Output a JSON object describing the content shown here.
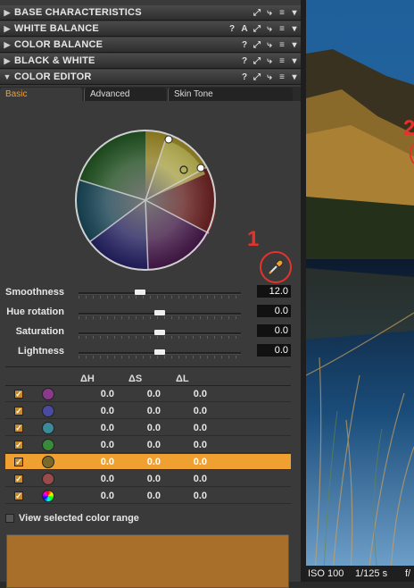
{
  "tools": [
    {
      "name": "BASE CHARACTERISTICS",
      "icons": [
        "⤢",
        "⤷",
        "≡",
        "▾"
      ]
    },
    {
      "name": "WHITE BALANCE",
      "icons": [
        "?",
        "A",
        "⤢",
        "⤷",
        "≡",
        "▾"
      ]
    },
    {
      "name": "COLOR BALANCE",
      "icons": [
        "?",
        "⤢",
        "⤷",
        "≡",
        "▾"
      ]
    },
    {
      "name": "BLACK & WHITE",
      "icons": [
        "?",
        "⤢",
        "⤷",
        "≡",
        "▾"
      ]
    },
    {
      "name": "COLOR EDITOR",
      "icons": [
        "?",
        "⤢",
        "⤷",
        "≡",
        "▾"
      ]
    }
  ],
  "tabs": {
    "basic": "Basic",
    "advanced": "Advanced",
    "skin_tone": "Skin Tone"
  },
  "sliders": {
    "smoothness": {
      "label": "Smoothness",
      "value": "12.0",
      "level": 0.38
    },
    "hue_rotation": {
      "label": "Hue rotation",
      "value": "0.0",
      "level": 0.5
    },
    "saturation": {
      "label": "Saturation",
      "value": "0.0",
      "level": 0.5
    },
    "lightness": {
      "label": "Lightness",
      "value": "0.0",
      "level": 0.5
    }
  },
  "table": {
    "headers": {
      "dh": "ΔH",
      "ds": "ΔS",
      "dl": "ΔL"
    },
    "rows": [
      {
        "color": "#8a3a8a",
        "dh": "0.0",
        "ds": "0.0",
        "dl": "0.0",
        "selected": false
      },
      {
        "color": "#4a4aa0",
        "dh": "0.0",
        "ds": "0.0",
        "dl": "0.0",
        "selected": false
      },
      {
        "color": "#3a8a9a",
        "dh": "0.0",
        "ds": "0.0",
        "dl": "0.0",
        "selected": false
      },
      {
        "color": "#3a8a3a",
        "dh": "0.0",
        "ds": "0.0",
        "dl": "0.0",
        "selected": false
      },
      {
        "color": "#7a6a2a",
        "dh": "0.0",
        "ds": "0.0",
        "dl": "0.0",
        "selected": true
      },
      {
        "color": "#9a4a4a",
        "dh": "0.0",
        "ds": "0.0",
        "dl": "0.0",
        "selected": false
      },
      {
        "color": "rainbow",
        "dh": "0.0",
        "ds": "0.0",
        "dl": "0.0",
        "selected": false
      }
    ]
  },
  "view_range": {
    "label": "View selected color range"
  },
  "swatch_color": "#a86f2a",
  "annotations": {
    "one": "1",
    "two": "2"
  },
  "status": {
    "iso": "ISO 100",
    "shutter": "1/125 s",
    "aperture": "f/"
  }
}
